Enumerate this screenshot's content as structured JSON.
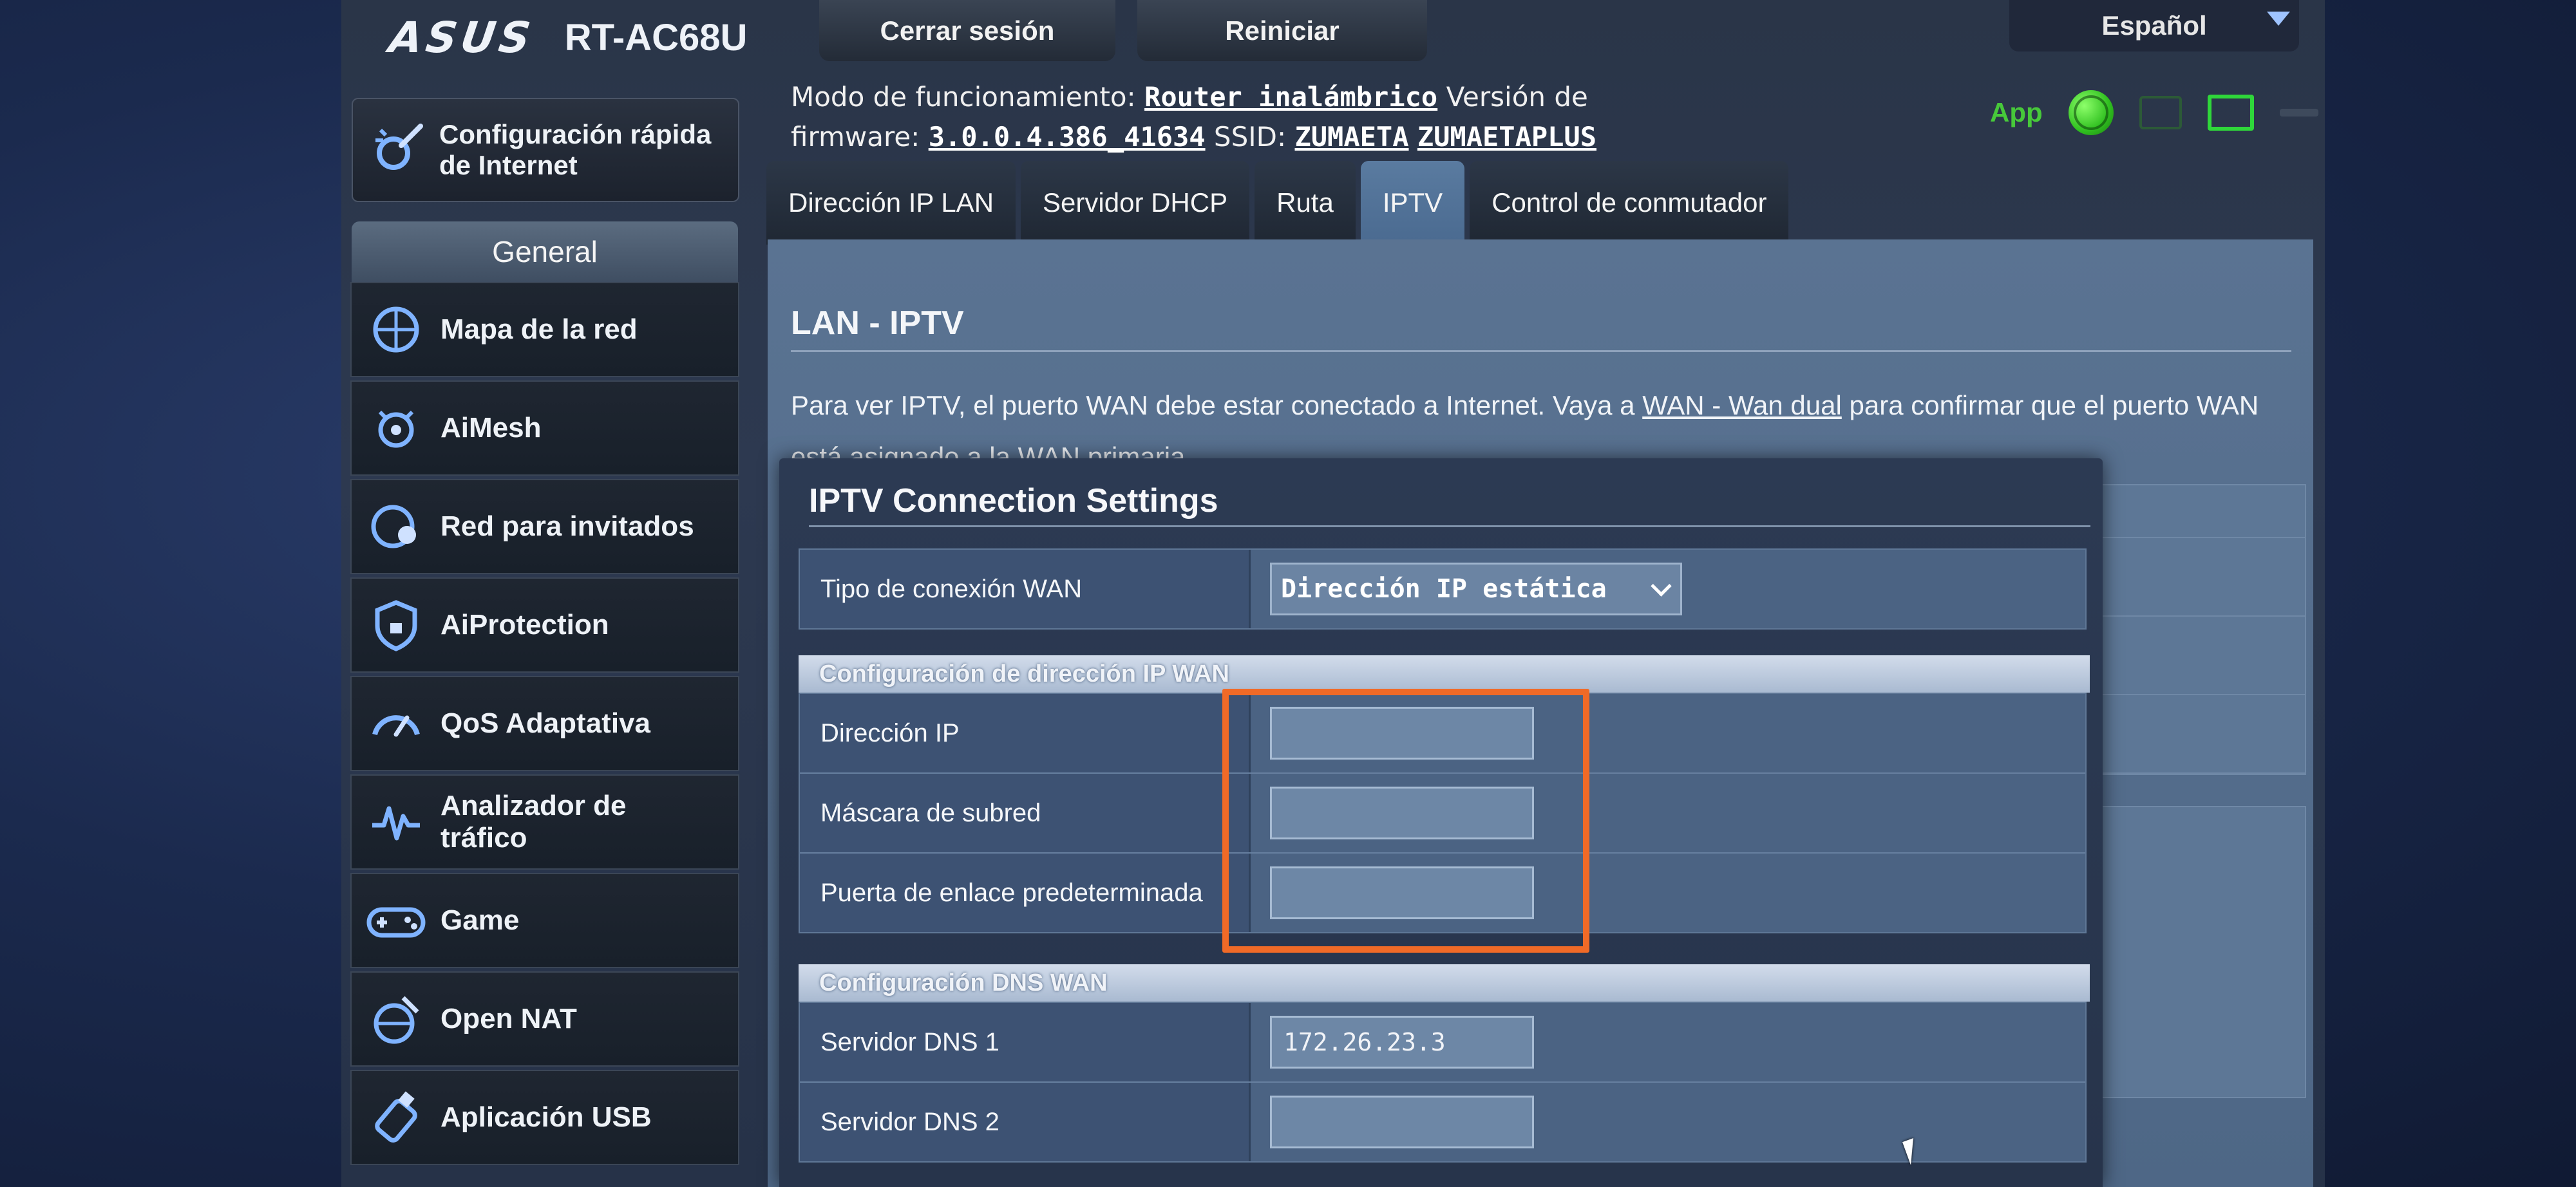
{
  "header": {
    "brand": "ASUS",
    "model": "RT-AC68U",
    "logout_label": "Cerrar sesión",
    "reboot_label": "Reiniciar",
    "language": "Español",
    "mode_label": "Modo de funcionamiento:",
    "mode_value": "Router inalámbrico",
    "firmware_label_1": "Versión de",
    "firmware_label_2": "firmware:",
    "firmware_value": "3.0.0.4.386_41634",
    "ssid_label": "SSID:",
    "ssid_1": "ZUMAETA",
    "ssid_2": "ZUMAETAPLUS",
    "app_label": "App"
  },
  "sidebar": {
    "quick_setup": "Configuración rápida de Internet",
    "general_header": "General",
    "items": [
      {
        "label": "Mapa de la red",
        "icon": "network-map-icon"
      },
      {
        "label": "AiMesh",
        "icon": "aimesh-icon"
      },
      {
        "label": "Red para invitados",
        "icon": "guest-network-icon"
      },
      {
        "label": "AiProtection",
        "icon": "aiprotection-shield-icon"
      },
      {
        "label": "QoS Adaptativa",
        "icon": "qos-gauge-icon"
      },
      {
        "label": "Analizador de tráfico",
        "icon": "traffic-analyzer-icon"
      },
      {
        "label": "Game",
        "icon": "gamepad-icon"
      },
      {
        "label": "Open NAT",
        "icon": "open-nat-icon"
      },
      {
        "label": "Aplicación USB",
        "icon": "usb-app-icon"
      }
    ]
  },
  "tabs": [
    {
      "label": "Dirección IP LAN",
      "active": false
    },
    {
      "label": "Servidor DHCP",
      "active": false
    },
    {
      "label": "Ruta",
      "active": false
    },
    {
      "label": "IPTV",
      "active": true
    },
    {
      "label": "Control de conmutador",
      "active": false
    }
  ],
  "content": {
    "title": "LAN - IPTV",
    "desc_before": "Para ver IPTV, el puerto WAN debe estar conectado a Internet. Vaya a ",
    "desc_link": "WAN - Wan dual",
    "desc_after": " para confirmar que el puerto WAN está asignado a la WAN primaria."
  },
  "dialog": {
    "title": "IPTV Connection Settings",
    "wan_type_label": "Tipo de conexión WAN",
    "wan_type_value": "Dirección IP estática",
    "ip_section": "Configuración de dirección IP WAN",
    "ip_label": "Dirección IP",
    "ip_value": "",
    "mask_label": "Máscara de subred",
    "mask_value": "",
    "gateway_label": "Puerta de enlace predeterminada",
    "gateway_value": "",
    "dns_section": "Configuración DNS WAN",
    "dns1_label": "Servidor DNS 1",
    "dns1_value": "172.26.23.3",
    "dns2_label": "Servidor DNS 2",
    "dns2_value": ""
  },
  "colors": {
    "highlight_box": "#f06a27",
    "app_green": "#47c83a",
    "active_tab": "#5a7ba0"
  }
}
